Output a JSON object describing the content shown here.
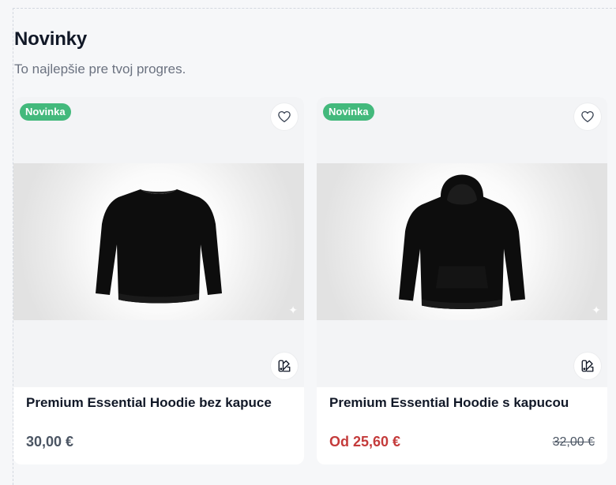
{
  "section": {
    "title": "Novinky",
    "subtitle": "To najlepšie pre tvoj progres."
  },
  "products": [
    {
      "badge": "Novinka",
      "name": "Premium Essential Hoodie bez kapuce",
      "price": "30,00 €",
      "old_price": "",
      "garment": "crewneck-sweatshirt",
      "fav_icon": "heart-icon",
      "variants_icon": "color-swatch-icon"
    },
    {
      "badge": "Novinka",
      "name": "Premium Essential Hoodie s kapucou",
      "price": "Od 25,60 €",
      "old_price": "32,00 €",
      "garment": "hooded-sweatshirt",
      "fav_icon": "heart-icon",
      "variants_icon": "color-swatch-icon"
    }
  ],
  "colors": {
    "badge": "#43b97c",
    "sale_price": "#c43b3b",
    "regular_price": "#4b5563"
  }
}
